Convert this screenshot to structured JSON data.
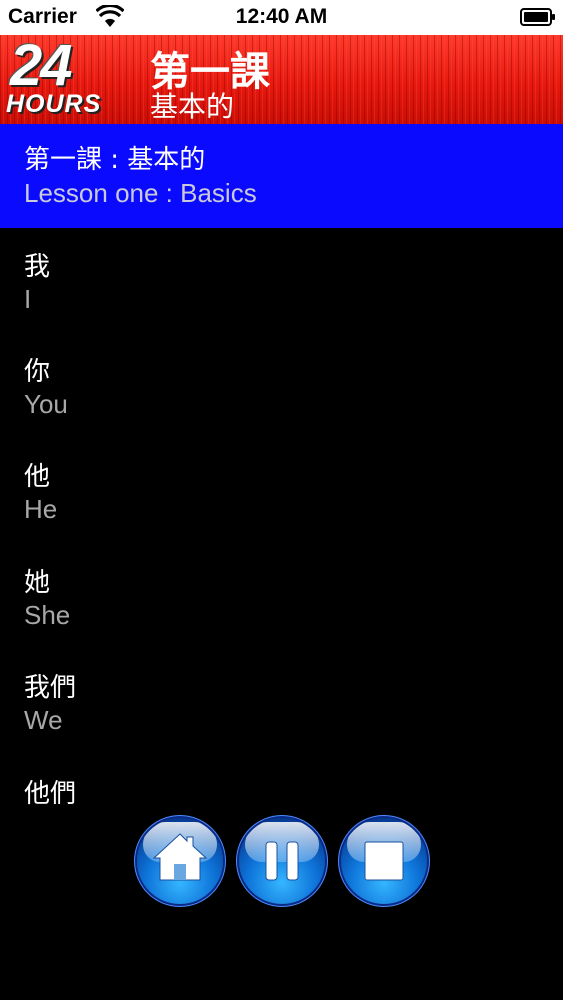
{
  "status_bar": {
    "carrier": "Carrier",
    "time": "12:40 AM",
    "wifi_icon": "wifi-icon",
    "battery_icon": "battery-icon"
  },
  "header": {
    "logo_number": "24",
    "logo_word": "HOURS",
    "title": "第一課",
    "subtitle": "基本的",
    "color": "#e8190f"
  },
  "selected_lesson": {
    "chinese": "第一課 : 基本的",
    "english": "Lesson one : Basics",
    "color": "#0a0aff"
  },
  "vocab": [
    {
      "chinese": "我",
      "english": "I"
    },
    {
      "chinese": "你",
      "english": "You"
    },
    {
      "chinese": "他",
      "english": "He"
    },
    {
      "chinese": "她",
      "english": "She"
    },
    {
      "chinese": "我們",
      "english": "We"
    },
    {
      "chinese": "他們",
      "english": ""
    }
  ],
  "controls": [
    {
      "name": "home-button",
      "icon": "home-icon"
    },
    {
      "name": "pause-button",
      "icon": "pause-icon"
    },
    {
      "name": "stop-button",
      "icon": "stop-icon"
    }
  ]
}
